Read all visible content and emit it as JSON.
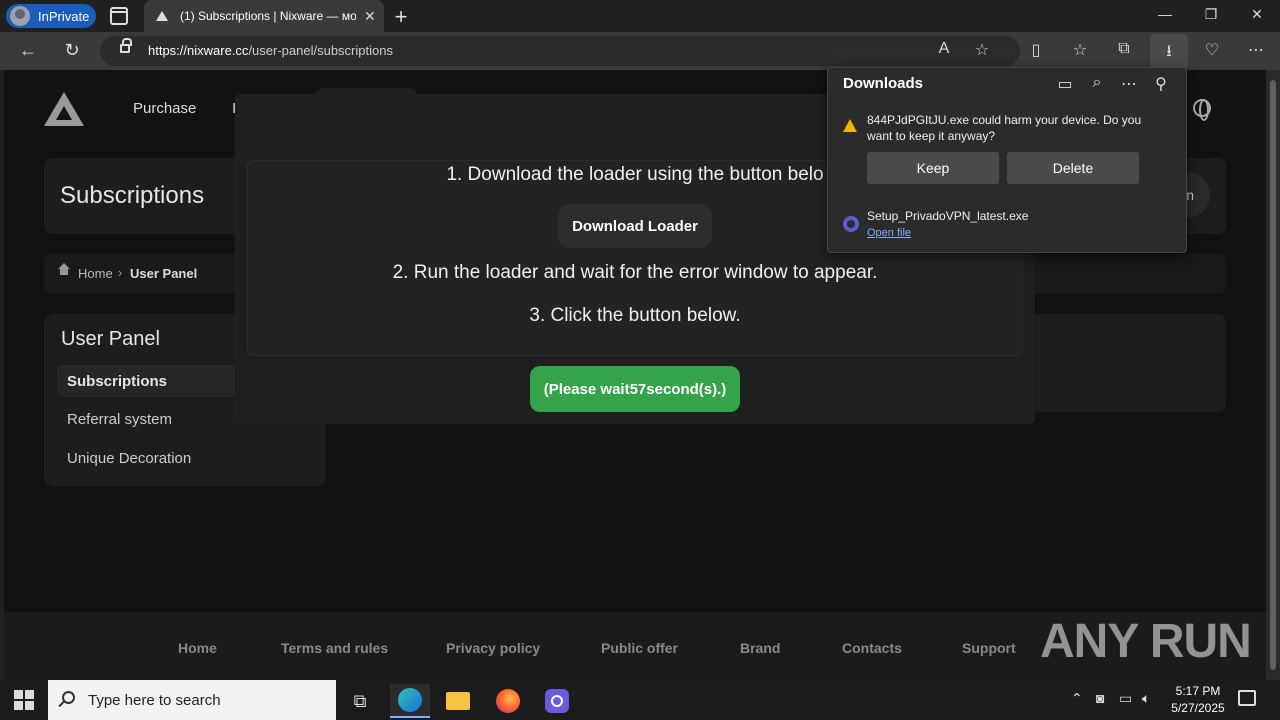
{
  "browser": {
    "inprivate_label": "InPrivate",
    "tab_title": "(1) Subscriptions | Nixware — мо",
    "tab_close": "✕",
    "new_tab": "+",
    "url_host": "https://nixware.cc",
    "url_path": "/user-panel/subscriptions",
    "window_buttons": [
      "—",
      "❐",
      "✕"
    ],
    "icons": [
      "read-aloud-icon",
      "favorite-star-icon",
      "split-screen-icon",
      "favorites-icon",
      "collections-icon",
      "downloads-icon",
      "browser-essentials-icon",
      "more-icon"
    ]
  },
  "site": {
    "nav_purchase": "Purchase",
    "nav_partial": "I",
    "page_title": "Subscriptions",
    "right_button_partial": "n",
    "breadcrumb": {
      "home": "Home",
      "sep": "›",
      "current": "User Panel"
    },
    "panel_title": "User Panel",
    "menu": [
      "Subscriptions",
      "Referral system",
      "Unique Decoration"
    ],
    "footer_links": [
      "Home",
      "Terms and rules",
      "Privacy policy",
      "Public offer",
      "Brand",
      "Contacts",
      "Support"
    ]
  },
  "modal": {
    "step1": "1. Download the loader using the button belo",
    "download_button": "Download Loader",
    "step2": "2. Run the loader and wait for the error window to appear.",
    "step3": "3. Click the button below.",
    "wait_prefix": "(Please wait ",
    "wait_seconds": "57",
    "wait_suffix": " second(s).)"
  },
  "downloads": {
    "title": "Downloads",
    "warning": "844PJdPGItJU.exe could harm your device. Do you want to keep it anyway?",
    "keep": "Keep",
    "delete": "Delete",
    "file_name": "Setup_PrivadoVPN_latest.exe",
    "open_file": "Open file"
  },
  "taskbar": {
    "search_placeholder": "Type here to search",
    "time": "5:17 PM",
    "date": "5/27/2025"
  },
  "watermark": "ANY RUN",
  "colors": {
    "accent_green": "#34a34a",
    "inprivate_blue": "#1b5dbf",
    "warning_yellow": "#f0b400"
  }
}
